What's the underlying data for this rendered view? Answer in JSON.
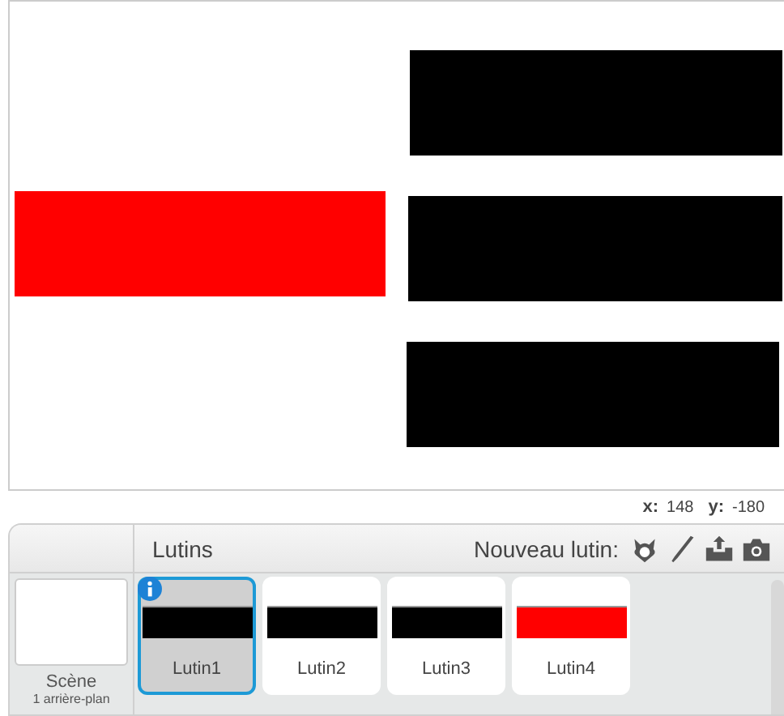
{
  "coordinates": {
    "x_label": "x:",
    "x_value": "148",
    "y_label": "y:",
    "y_value": "-180"
  },
  "sprites_panel": {
    "title": "Lutins",
    "new_sprite_label": "Nouveau lutin:"
  },
  "scene": {
    "label": "Scène",
    "backdrops": "1 arrière-plan"
  },
  "sprites": [
    {
      "name": "Lutin1",
      "color": "#000000",
      "selected": true
    },
    {
      "name": "Lutin2",
      "color": "#000000",
      "selected": false
    },
    {
      "name": "Lutin3",
      "color": "#000000",
      "selected": false
    },
    {
      "name": "Lutin4",
      "color": "#ff0000",
      "selected": false
    }
  ]
}
